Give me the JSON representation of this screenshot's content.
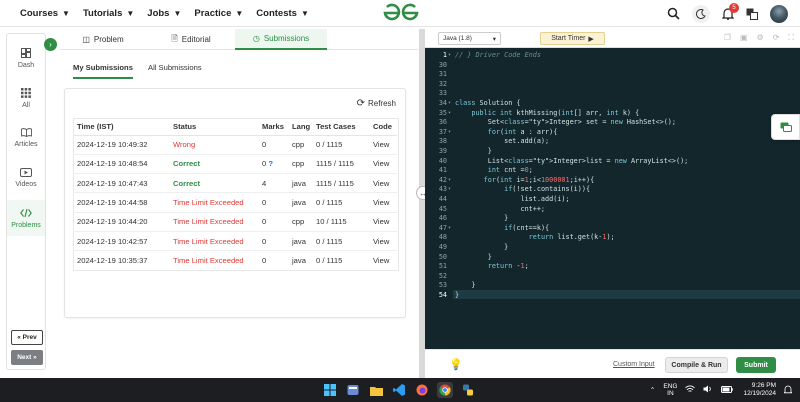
{
  "nav": {
    "items": [
      "Courses",
      "Tutorials",
      "Jobs",
      "Practice",
      "Contests"
    ],
    "notification_count": "5"
  },
  "sidebar": {
    "items": [
      {
        "label": "Dash"
      },
      {
        "label": "All"
      },
      {
        "label": "Articles"
      },
      {
        "label": "Videos"
      },
      {
        "label": "Problems"
      }
    ],
    "prev_label": "« Prev",
    "next_label": "Next »"
  },
  "tabs": [
    "Problem",
    "Editorial",
    "Submissions"
  ],
  "subtabs": [
    "My Submissions",
    "All Submissions"
  ],
  "refresh_label": "Refresh",
  "table": {
    "headers": [
      "Time (IST)",
      "Status",
      "Marks",
      "Lang",
      "Test Cases",
      "Code"
    ],
    "rows": [
      {
        "time": "2024-12-19 10:49:32",
        "status": "Wrong",
        "marks": "0",
        "lang": "cpp",
        "tests": "0 / 1115",
        "code": "View"
      },
      {
        "time": "2024-12-19 10:48:54",
        "status": "Correct",
        "marks": "0",
        "lang": "cpp",
        "tests": "1115 / 1115",
        "code": "View"
      },
      {
        "time": "2024-12-19 10:47:43",
        "status": "Correct",
        "marks": "4",
        "lang": "java",
        "tests": "1115 / 1115",
        "code": "View"
      },
      {
        "time": "2024-12-19 10:44:58",
        "status": "Time Limit Exceeded",
        "marks": "0",
        "lang": "java",
        "tests": "0 / 1115",
        "code": "View"
      },
      {
        "time": "2024-12-19 10:44:20",
        "status": "Time Limit Exceeded",
        "marks": "0",
        "lang": "cpp",
        "tests": "10 / 1115",
        "code": "View"
      },
      {
        "time": "2024-12-19 10:42:57",
        "status": "Time Limit Exceeded",
        "marks": "0",
        "lang": "java",
        "tests": "0 / 1115",
        "code": "View"
      },
      {
        "time": "2024-12-19 10:35:37",
        "status": "Time Limit Exceeded",
        "marks": "0",
        "lang": "java",
        "tests": "0 / 1115",
        "code": "View"
      }
    ],
    "question_mark": "?"
  },
  "editor": {
    "language": "Java (1.8)",
    "timer_label": "Start Timer",
    "lines": [
      {
        "n": "1",
        "text": "// } Driver Code Ends"
      },
      {
        "n": "30",
        "text": ""
      },
      {
        "n": "31",
        "text": ""
      },
      {
        "n": "32",
        "text": ""
      },
      {
        "n": "33",
        "text": ""
      },
      {
        "n": "34",
        "text": "class Solution {"
      },
      {
        "n": "35",
        "text": "    public int kthMissing(int[] arr, int k) {"
      },
      {
        "n": "36",
        "text": "        Set<Integer> set = new HashSet<>();"
      },
      {
        "n": "37",
        "text": "        for(int a : arr){"
      },
      {
        "n": "38",
        "text": "            set.add(a);"
      },
      {
        "n": "39",
        "text": "        }"
      },
      {
        "n": "40",
        "text": "        List<Integer>list = new ArrayList<>();"
      },
      {
        "n": "41",
        "text": "        int cnt =0;"
      },
      {
        "n": "42",
        "text": "       for(int i=1;i<1000001;i++){"
      },
      {
        "n": "43",
        "text": "            if(!set.contains(i)){"
      },
      {
        "n": "44",
        "text": "                list.add(i);"
      },
      {
        "n": "45",
        "text": "                cnt++;"
      },
      {
        "n": "46",
        "text": "            }"
      },
      {
        "n": "47",
        "text": "            if(cnt==k){"
      },
      {
        "n": "48",
        "text": "                  return list.get(k-1);"
      },
      {
        "n": "49",
        "text": "            }"
      },
      {
        "n": "50",
        "text": "        }"
      },
      {
        "n": "51",
        "text": "        return -1;"
      },
      {
        "n": "52",
        "text": ""
      },
      {
        "n": "53",
        "text": "    }"
      },
      {
        "n": "54",
        "text": "}"
      }
    ],
    "custom_input_label": "Custom Input",
    "compile_label": "Compile & Run",
    "submit_label": "Submit"
  },
  "taskbar": {
    "lang_top": "ENG",
    "lang_bottom": "IN",
    "time": "9:26 PM",
    "date": "12/19/2024"
  },
  "colors": {
    "brand_green": "#2f8d46",
    "error_red": "#e53935",
    "editor_bg": "#12262c"
  }
}
